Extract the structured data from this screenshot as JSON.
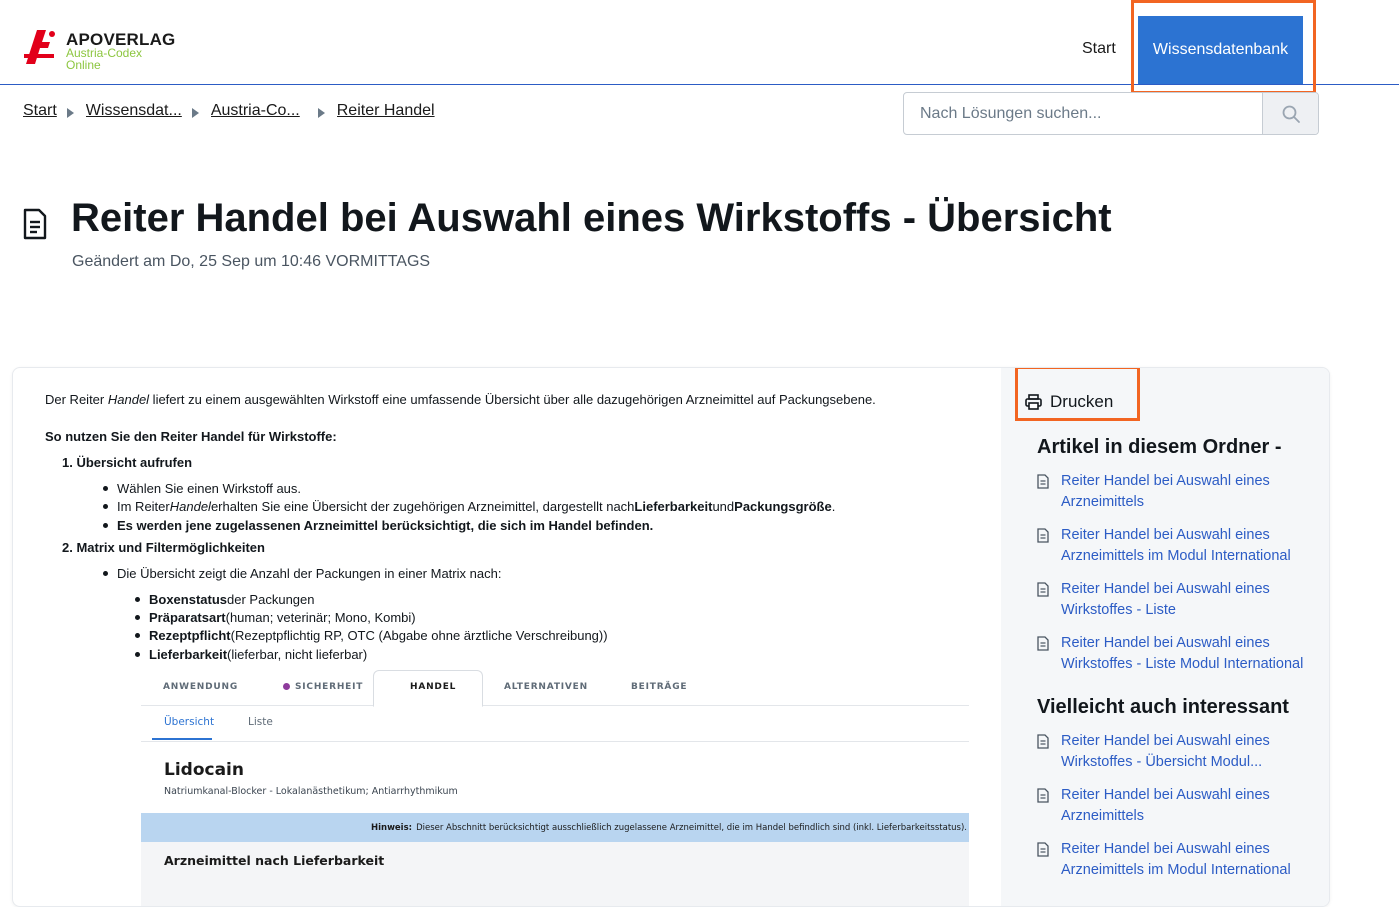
{
  "header": {
    "brand": "APOVERLAG",
    "brand_sub1": "Austria-Codex",
    "brand_sub2": "Online",
    "nav_start": "Start",
    "nav_kb": "Wissensdatenbank"
  },
  "breadcrumb": [
    "Start",
    "Wissensdat...",
    "Austria-Co...",
    "Reiter Handel"
  ],
  "search": {
    "placeholder": "Nach Lösungen suchen..."
  },
  "article": {
    "title": "Reiter Handel bei Auswahl eines Wirkstoffs - Übersicht",
    "modified": "Geändert am Do, 25 Sep um 10:46 VORMITTAGS",
    "intro_a": "Der Reiter ",
    "intro_em": "Handel",
    "intro_b": " liefert zu einem ausgewählten Wirkstoff eine umfassende Übersicht über alle dazugehörigen Arzneimittel auf Packungsebene.",
    "how_heading": "So nutzen Sie den Reiter Handel für Wirkstoffe:",
    "step1": "1. Übersicht aufrufen",
    "step1_b1": "Wählen Sie einen Wirkstoff aus.",
    "step1_b2_a": "Im Reiter ",
    "step1_b2_em": "Handel",
    "step1_b2_b": " erhalten Sie eine Übersicht der zugehörigen Arzneimittel, dargestellt nach ",
    "step1_b2_s1": "Lieferbarkeit",
    "step1_b2_c": " und ",
    "step1_b2_s2": "Packungsgröße",
    "step1_b2_d": ".",
    "step1_b3": "Es werden jene zugelassenen Arzneimittel berücksichtigt, die sich im Handel befinden.",
    "step2": "2. Matrix und Filtermöglichkeiten",
    "step2_b1": "Die Übersicht zeigt die Anzahl der Packungen in einer Matrix nach:",
    "sub1_s": "Boxenstatus",
    "sub1_t": " der Packungen",
    "sub2_s": "Präparatsart",
    "sub2_t": " (human; veterinär; Mono, Kombi)",
    "sub3_s": "Rezeptpflicht",
    "sub3_t": " (Rezeptpflichtig RP, OTC (Abgabe ohne ärztliche Verschreibung))",
    "sub4_s": "Lieferbarkeit",
    "sub4_t": " (lieferbar, nicht lieferbar)"
  },
  "screenshot": {
    "tabs": [
      "ANWENDUNG",
      "SICHERHEIT",
      "HANDEL",
      "ALTERNATIVEN",
      "BEITRÄGE"
    ],
    "subtabs": [
      "Übersicht",
      "Liste"
    ],
    "drug_name": "Lidocain",
    "drug_class": "Natriumkanal-Blocker - Lokalanästhetikum; Antiarrhythmikum",
    "hint_label": "Hinweis:",
    "hint_text": "Dieser Abschnitt berücksichtigt ausschließlich zugelassene Arzneimittel, die im Handel befindlich sind (inkl. Lieferbarkeitsstatus).",
    "section": "Arzneimittel nach Lieferbarkeit"
  },
  "sidebar": {
    "print": "Drucken",
    "folder_heading": "Artikel in diesem Ordner -",
    "folder_links": [
      [
        "Reiter Handel bei Auswahl eines",
        "Arzneimittels"
      ],
      [
        "Reiter Handel bei Auswahl eines",
        "Arzneimittels im Modul International"
      ],
      [
        "Reiter Handel bei Auswahl eines",
        "Wirkstoffes - Liste"
      ],
      [
        "Reiter Handel bei Auswahl eines",
        "Wirkstoffes - Liste Modul International"
      ]
    ],
    "related_heading": "Vielleicht auch interessant",
    "related_links": [
      [
        "Reiter Handel bei Auswahl eines",
        "Wirkstoffes - Übersicht Modul..."
      ],
      [
        "Reiter Handel bei Auswahl eines",
        "Arzneimittels"
      ],
      [
        "Reiter Handel bei Auswahl eines",
        "Arzneimittels im Modul International"
      ]
    ]
  },
  "colors": {
    "accent": "#2c73d2",
    "highlight": "#f26522",
    "link": "#2c5cc5",
    "logo_red": "#e2001a",
    "logo_green": "#8cc63f"
  }
}
